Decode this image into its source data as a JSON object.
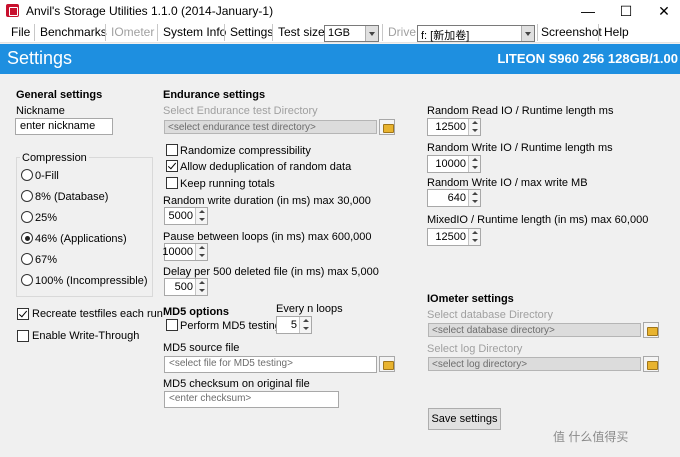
{
  "window": {
    "title": "Anvil's Storage Utilities 1.1.0 (2014-January-1)",
    "minimize_glyph": "—",
    "maximize_glyph": "☐",
    "close_glyph": "✕"
  },
  "menu": {
    "file": "File",
    "benchmarks": "Benchmarks",
    "iometer": "IOmeter",
    "system_info": "System Info",
    "settings": "Settings",
    "test_size_label": "Test size",
    "test_size_value": "1GB",
    "drive_label": "Drive",
    "drive_value": "f: [新加卷]",
    "screenshot": "Screenshot",
    "help": "Help"
  },
  "header": {
    "title": "Settings",
    "drive_model": "LITEON S960 256 128GB/1.00"
  },
  "general": {
    "heading": "General settings",
    "nickname_label": "Nickname",
    "nickname_value": "enter nickname",
    "compression_title": "Compression",
    "compression_options": [
      "0-Fill",
      "8% (Database)",
      "25%",
      "46% (Applications)",
      "67%",
      "100% (Incompressible)"
    ],
    "selected_compression": "46% (Applications)",
    "recreate_label": "Recreate testfiles each run",
    "recreate_checked": true,
    "write_through_label": "Enable Write-Through",
    "write_through_checked": false
  },
  "endurance": {
    "heading": "Endurance settings",
    "dir_label": "Select Endurance test Directory",
    "dir_placeholder": "<select endurance test directory>",
    "randomize_label": "Randomize compressibility",
    "randomize_checked": false,
    "dedup_label": "Allow deduplication of random data",
    "dedup_checked": true,
    "keep_totals_label": "Keep running totals",
    "keep_totals_checked": false,
    "rw_duration_label": "Random write duration (in ms) max 30,000",
    "rw_duration_value": "5000",
    "pause_label": "Pause between loops (in ms) max 600,000",
    "pause_value": "10000",
    "delay_label": "Delay per 500 deleted file (in ms) max 5,000",
    "delay_value": "500"
  },
  "md5": {
    "heading": "MD5 options",
    "perform_label": "Perform MD5 testing",
    "perform_checked": false,
    "every_n_label": "Every n loops",
    "every_n_value": "5",
    "source_label": "MD5 source file",
    "source_placeholder": "<select file for MD5 testing>",
    "checksum_label": "MD5 checksum on original file",
    "checksum_placeholder": "<enter checksum>"
  },
  "runtime": {
    "rr_label": "Random Read IO / Runtime length ms",
    "rr_value": "12500",
    "rw_label": "Random Write IO / Runtime length ms",
    "rw_value": "10000",
    "rw_max_label": "Random Write IO / max write MB",
    "rw_max_value": "640",
    "mixed_label": "MixedIO / Runtime length (in ms) max 60,000",
    "mixed_value": "12500"
  },
  "iometer": {
    "heading": "IOmeter settings",
    "db_dir_label": "Select database Directory",
    "db_dir_placeholder": "<select database directory>",
    "log_dir_label": "Select log Directory",
    "log_dir_placeholder": "<select log directory>"
  },
  "save_button": "Save settings",
  "watermark": "值 什么值得买"
}
